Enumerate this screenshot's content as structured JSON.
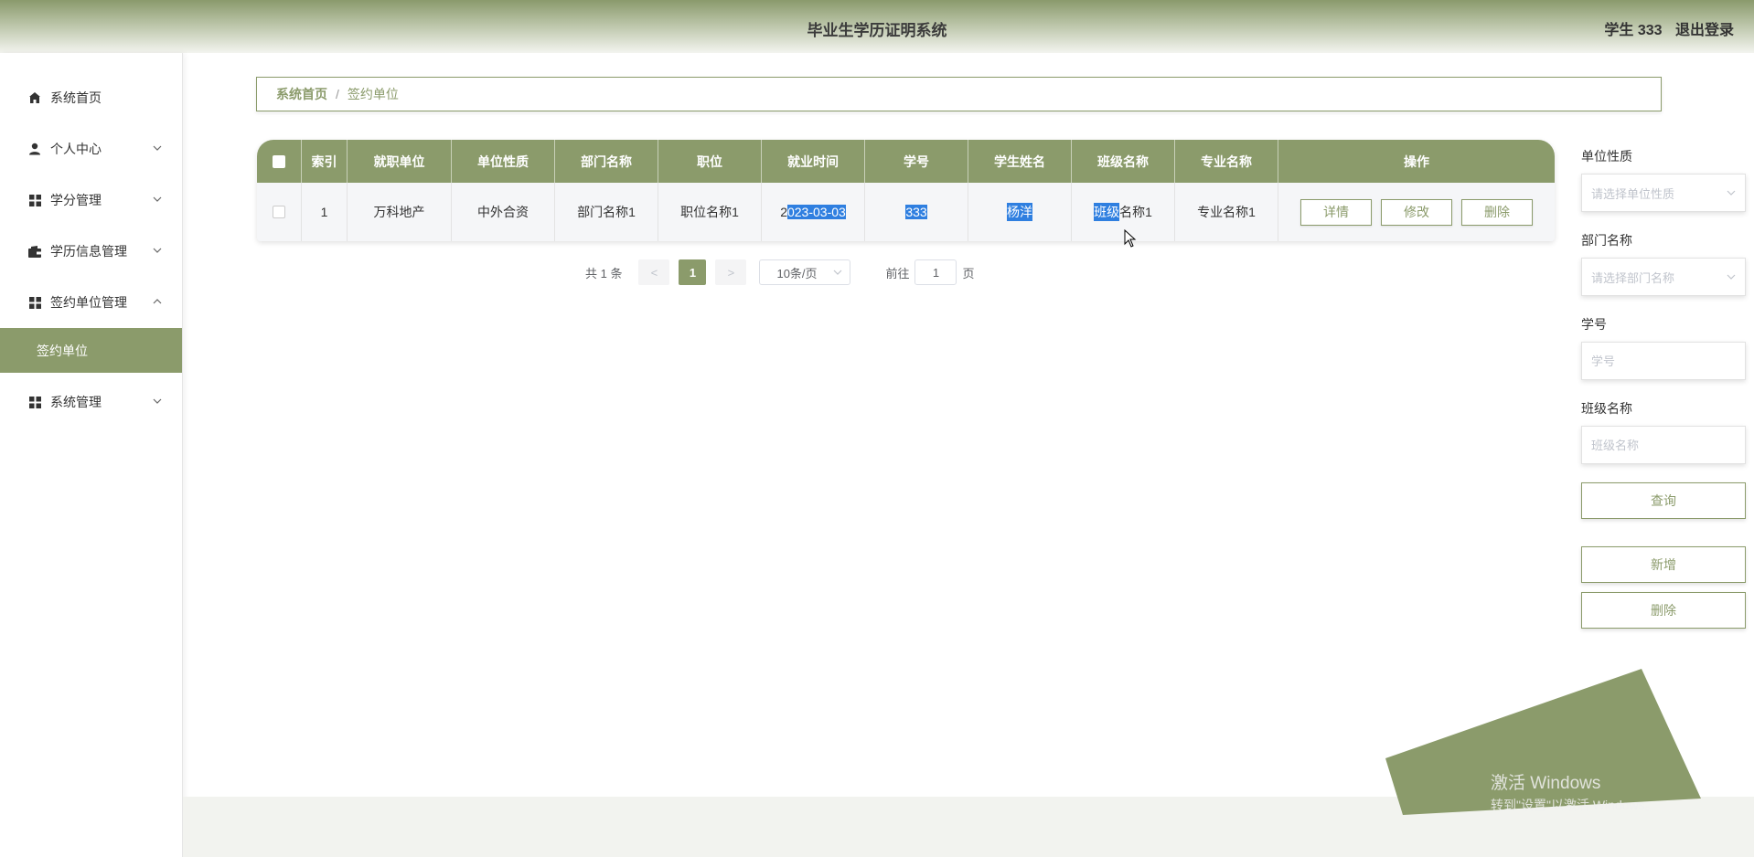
{
  "header": {
    "title": "毕业生学历证明系统",
    "user": "学生 333",
    "logout": "退出登录",
    "colors": {
      "accent": "#8b9b6b",
      "selection": "#2f7fe0"
    }
  },
  "sidebar": {
    "items": [
      {
        "label": "系统首页",
        "icon": "home-icon"
      },
      {
        "label": "个人中心",
        "icon": "user-icon"
      },
      {
        "label": "学分管理",
        "icon": "grid-icon"
      },
      {
        "label": "学历信息管理",
        "icon": "wallet-icon"
      },
      {
        "label": "签约单位管理",
        "icon": "grid-icon",
        "expanded": true
      },
      {
        "label": "系统管理",
        "icon": "grid-icon"
      }
    ],
    "active_sub": "签约单位"
  },
  "breadcrumb": {
    "home": "系统首页",
    "separator": "/",
    "current": "签约单位"
  },
  "table": {
    "columns": [
      "索引",
      "就职单位",
      "单位性质",
      "部门名称",
      "职位",
      "就业时间",
      "学号",
      "学生姓名",
      "班级名称",
      "专业名称",
      "操作"
    ],
    "rows": [
      {
        "index": "1",
        "company": "万科地产",
        "nature": "中外合资",
        "dept": "部门名称1",
        "position": "职位名称1",
        "date_first": "2",
        "date_rest": "023-03-03",
        "student_no": "333",
        "student_name": "杨洋",
        "class_sel": "班级",
        "class_rest": "名称1",
        "major": "专业名称1"
      }
    ],
    "actions": {
      "detail": "详情",
      "edit": "修改",
      "delete": "删除"
    }
  },
  "pagination": {
    "total": "共 1 条",
    "prev": "<",
    "current": "1",
    "next": ">",
    "page_size": "10条/页",
    "goto_label": "前往",
    "goto_value": "1",
    "goto_suffix": "页"
  },
  "filters": {
    "nature_label": "单位性质",
    "nature_placeholder": "请选择单位性质",
    "dept_label": "部门名称",
    "dept_placeholder": "请选择部门名称",
    "student_no_label": "学号",
    "student_no_placeholder": "学号",
    "class_label": "班级名称",
    "class_placeholder": "班级名称",
    "query": "查询",
    "add": "新增",
    "delete": "删除"
  },
  "watermark": {
    "line1": "激活 Windows",
    "line2": "转到\"设置\"以激活 Windows。"
  }
}
